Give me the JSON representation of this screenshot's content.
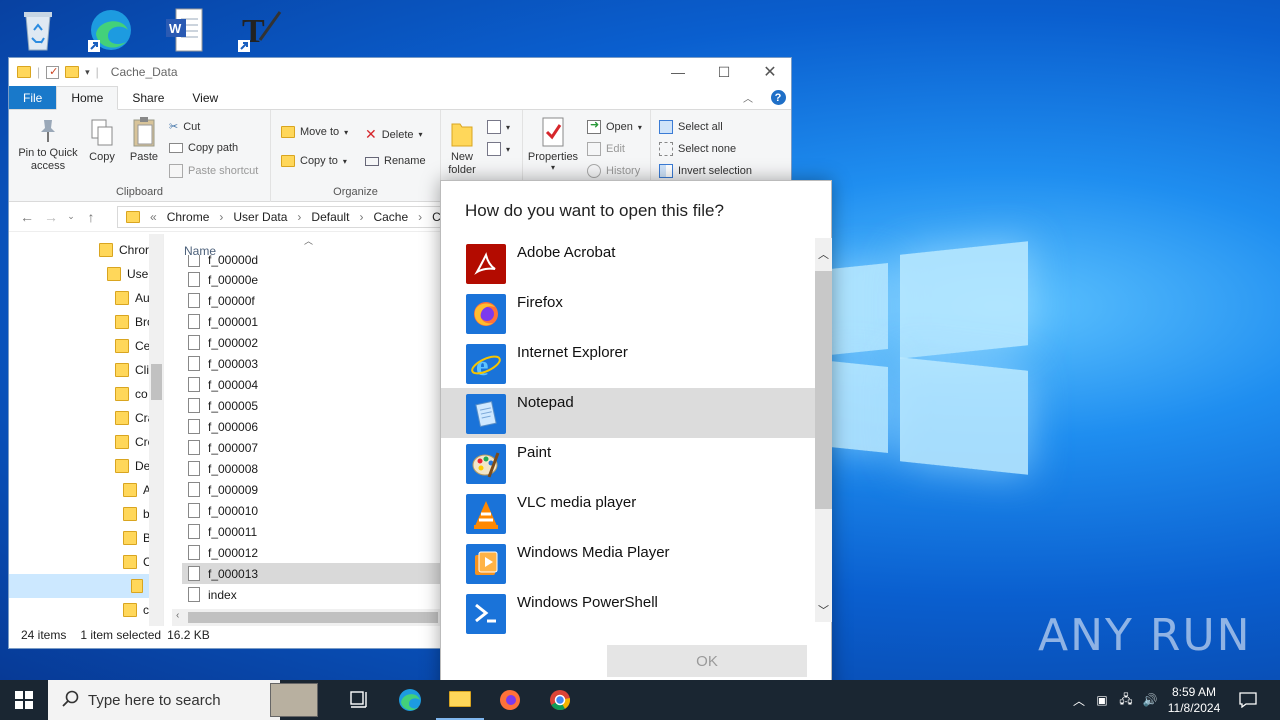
{
  "explorer": {
    "title": "Cache_Data",
    "tabs": [
      "File",
      "Home",
      "Share",
      "View"
    ],
    "ribbon": {
      "clipboard": {
        "pin_label": "Pin to Quick access",
        "copy_label": "Copy",
        "paste_label": "Paste",
        "cut_label": "Cut",
        "copy_path_label": "Copy path",
        "paste_shortcut_label": "Paste shortcut",
        "group_label": "Clipboard"
      },
      "organize": {
        "move_to_label": "Move to",
        "copy_to_label": "Copy to",
        "delete_label": "Delete",
        "rename_label": "Rename",
        "group_label": "Organize"
      },
      "new": {
        "new_folder_label": "New folder"
      },
      "open": {
        "properties_label": "Properties",
        "open_label": "Open",
        "edit_label": "Edit",
        "history_label": "History"
      },
      "select": {
        "select_all_label": "Select all",
        "select_none_label": "Select none",
        "invert_label": "Invert selection"
      }
    },
    "breadcrumb": [
      "Chrome",
      "User Data",
      "Default",
      "Cache",
      "Cache"
    ],
    "breadcrumb_prefix": "«",
    "nav_items": [
      "Chror",
      "User",
      "Au",
      "Bro",
      "Ce",
      "Cli",
      "co",
      "Cra",
      "Cre",
      "De",
      "A",
      "b",
      "B",
      "C",
      "",
      "c"
    ],
    "column_name": "Name",
    "files": [
      "f_00000d",
      "f_00000e",
      "f_00000f",
      "f_000001",
      "f_000002",
      "f_000003",
      "f_000004",
      "f_000005",
      "f_000006",
      "f_000007",
      "f_000008",
      "f_000009",
      "f_000010",
      "f_000011",
      "f_000012",
      "f_000013",
      "index"
    ],
    "status": {
      "items": "24 items",
      "selected": "1 item selected",
      "size": "16.2 KB"
    }
  },
  "dialog": {
    "title": "How do you want to open this file?",
    "apps": [
      {
        "name": "Adobe Acrobat",
        "icon": "acrobat-icon",
        "color": "#b30b00"
      },
      {
        "name": "Firefox",
        "icon": "firefox-icon",
        "color": "#1a73d9"
      },
      {
        "name": "Internet Explorer",
        "icon": "ie-icon",
        "color": "#1a73d9"
      },
      {
        "name": "Notepad",
        "icon": "notepad-icon",
        "color": "#1a73d9"
      },
      {
        "name": "Paint",
        "icon": "paint-icon",
        "color": "#1a73d9"
      },
      {
        "name": "VLC media player",
        "icon": "vlc-icon",
        "color": "#1a73d9"
      },
      {
        "name": "Windows Media Player",
        "icon": "wmp-icon",
        "color": "#1a73d9"
      },
      {
        "name": "Windows PowerShell",
        "icon": "powershell-icon",
        "color": "#1a73d9"
      }
    ],
    "selected_app": "Notepad",
    "ok_label": "OK"
  },
  "taskbar": {
    "search_placeholder": "Type here to search",
    "time": "8:59 AM",
    "date": "11/8/2024"
  },
  "watermark": "ANY RUN"
}
